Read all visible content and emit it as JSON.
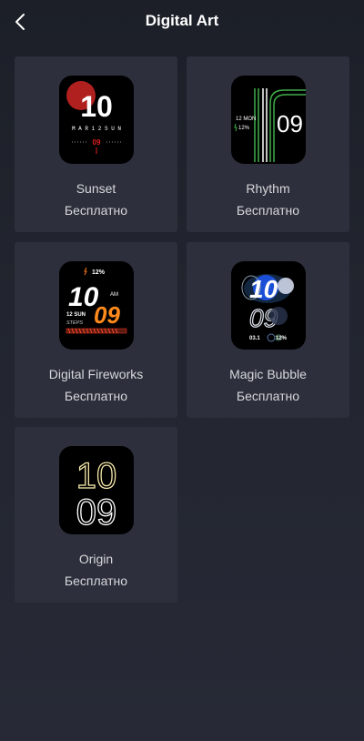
{
  "header": {
    "title": "Digital Art"
  },
  "cards": [
    {
      "name": "Sunset",
      "price": "Бесплатно",
      "face": {
        "time": "10",
        "date": "M A R  1 2  S U N",
        "minute": "09"
      }
    },
    {
      "name": "Rhythm",
      "price": "Бесплатно",
      "face": {
        "date": "12 MON",
        "battery": "12%",
        "minute": "09"
      }
    },
    {
      "name": "Digital Fireworks",
      "price": "Бесплатно",
      "face": {
        "battery": "12%",
        "hour": "10",
        "ampm": "AM",
        "date": "12 SUN",
        "minute": "09",
        "steps": "STEPS"
      }
    },
    {
      "name": "Magic Bubble",
      "price": "Бесплатно",
      "face": {
        "hour": "10",
        "minute": "09",
        "date": "03.1",
        "battery": "12%"
      }
    },
    {
      "name": "Origin",
      "price": "Бесплатно",
      "face": {
        "hour": "10",
        "minute": "09"
      }
    }
  ]
}
